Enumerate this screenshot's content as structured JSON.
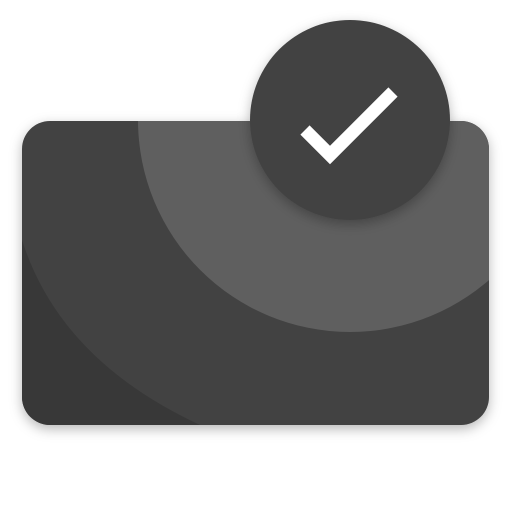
{
  "icon": {
    "name": "card-check-icon",
    "card_icon": "card-icon",
    "badge_icon": "checkmark-icon",
    "colors": {
      "card_base": "#424242",
      "card_dark_corner": "#383838",
      "card_light_arc": "#5f5f5f",
      "badge_fill": "#424242",
      "check": "#ffffff",
      "background": "#ffffff"
    }
  }
}
